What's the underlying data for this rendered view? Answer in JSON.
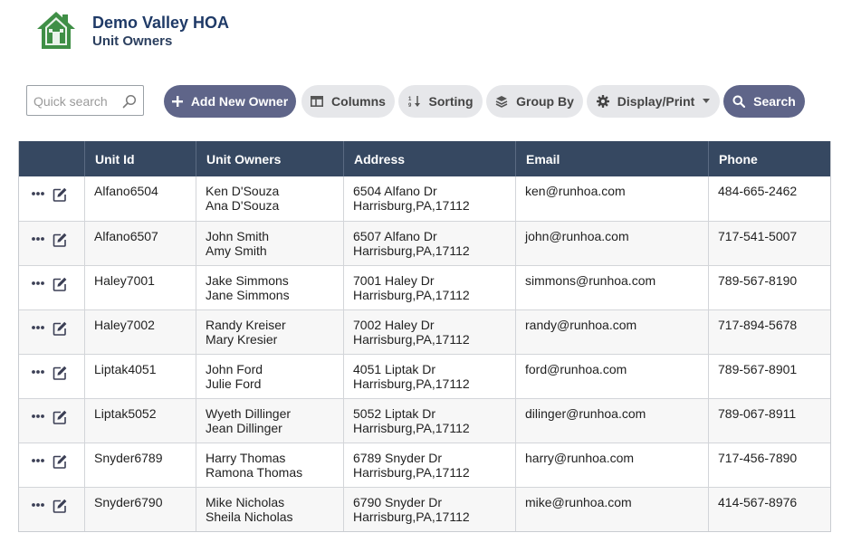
{
  "app": {
    "title": "Demo Valley HOA",
    "subtitle": "Unit Owners"
  },
  "colors": {
    "brand_green": "#3f8f46",
    "header_bg": "#364861",
    "primary_btn": "#5f6589",
    "secondary_btn": "#e6e7ea",
    "title": "#1f3a67"
  },
  "toolbar": {
    "search_placeholder": "Quick search",
    "search_value": "",
    "add_label": "Add New Owner",
    "columns_label": "Columns",
    "sorting_label": "Sorting",
    "groupby_label": "Group By",
    "display_label": "Display/Print",
    "search_label": "Search"
  },
  "icons": {
    "logo": "house-logo-icon",
    "add": "plus-icon",
    "columns": "columns-icon",
    "sorting": "sort-icon",
    "groupby": "layers-icon",
    "display": "gear-icon",
    "search": "search-icon",
    "row_menu": "more-icon",
    "row_edit": "edit-icon"
  },
  "table": {
    "columns": [
      "",
      "Unit Id",
      "Unit Owners",
      "Address",
      "Email",
      "Phone"
    ],
    "rows": [
      {
        "unit_id": "Alfano6504",
        "owner1": "Ken D'Souza",
        "owner2": "Ana D'Souza",
        "addr1": "6504 Alfano Dr",
        "addr2": "Harrisburg,PA,17112",
        "email": "ken@runhoa.com",
        "phone": "484-665-2462"
      },
      {
        "unit_id": "Alfano6507",
        "owner1": "John Smith",
        "owner2": "Amy Smith",
        "addr1": "6507 Alfano Dr",
        "addr2": "Harrisburg,PA,17112",
        "email": "john@runhoa.com",
        "phone": "717-541-5007"
      },
      {
        "unit_id": "Haley7001",
        "owner1": "Jake Simmons",
        "owner2": "Jane Simmons",
        "addr1": "7001 Haley Dr",
        "addr2": "Harrisburg,PA,17112",
        "email": "simmons@runhoa.com",
        "phone": "789-567-8190"
      },
      {
        "unit_id": "Haley7002",
        "owner1": "Randy Kreiser",
        "owner2": "Mary Kresier",
        "addr1": "7002 Haley Dr",
        "addr2": "Harrisburg,PA,17112",
        "email": "randy@runhoa.com",
        "phone": "717-894-5678"
      },
      {
        "unit_id": "Liptak4051",
        "owner1": "John Ford",
        "owner2": "Julie Ford",
        "addr1": "4051 Liptak Dr",
        "addr2": "Harrisburg,PA,17112",
        "email": "ford@runhoa.com",
        "phone": "789-567-8901"
      },
      {
        "unit_id": "Liptak5052",
        "owner1": "Wyeth Dillinger",
        "owner2": "Jean Dillinger",
        "addr1": "5052 Liptak Dr",
        "addr2": "Harrisburg,PA,17112",
        "email": "dilinger@runhoa.com",
        "phone": "789-067-8911"
      },
      {
        "unit_id": "Snyder6789",
        "owner1": "Harry Thomas",
        "owner2": "Ramona Thomas",
        "addr1": "6789 Snyder Dr",
        "addr2": "Harrisburg,PA,17112",
        "email": "harry@runhoa.com",
        "phone": "717-456-7890"
      },
      {
        "unit_id": "Snyder6790",
        "owner1": "Mike Nicholas",
        "owner2": "Sheila Nicholas",
        "addr1": "6790 Snyder Dr",
        "addr2": "Harrisburg,PA,17112",
        "email": "mike@runhoa.com",
        "phone": "414-567-8976"
      }
    ]
  }
}
